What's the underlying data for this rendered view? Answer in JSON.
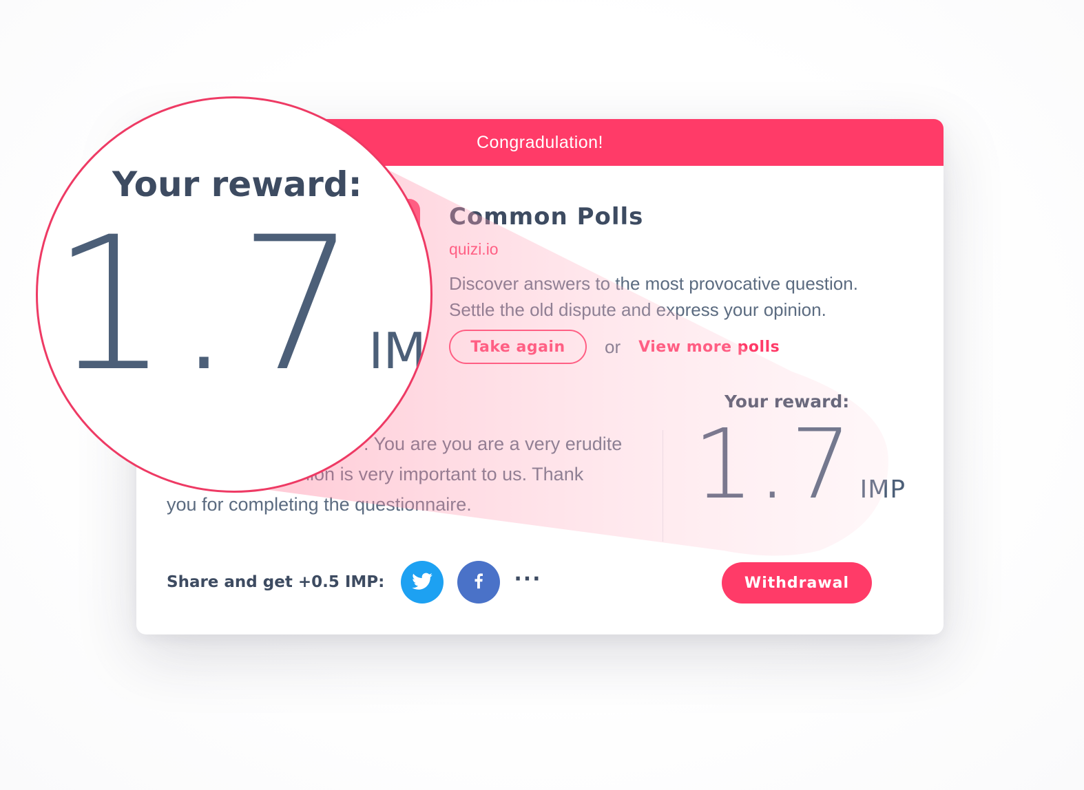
{
  "header": {
    "title": "Congradulation!"
  },
  "poll": {
    "title": "Common Polls",
    "source": "quizi.io",
    "description_line1": "Discover answers to the most provocative question.",
    "description_line2": "Settle the old dispute and express your opinion."
  },
  "actions": {
    "take_again": "Take again",
    "or": "or",
    "view_more": "View more polls"
  },
  "thanks": {
    "line1": ". You are you are a very erudite",
    "line2": "pinion is very important to us. Thank",
    "line3": "you for completing the questionnaire."
  },
  "reward": {
    "label": "Your reward:",
    "amount": "1.7",
    "unit": "IMP"
  },
  "share": {
    "label": "Share and get +0.5 IMP:",
    "more": "···"
  },
  "withdraw": {
    "label": "Withdrawal"
  },
  "colors": {
    "accent": "#ff3b68",
    "text_dark": "#3d4b61",
    "text_muted": "#5b6b80",
    "twitter": "#1da1f2",
    "facebook": "#4a72c8"
  },
  "icons": [
    "twitter-icon",
    "facebook-icon",
    "more-icon"
  ]
}
